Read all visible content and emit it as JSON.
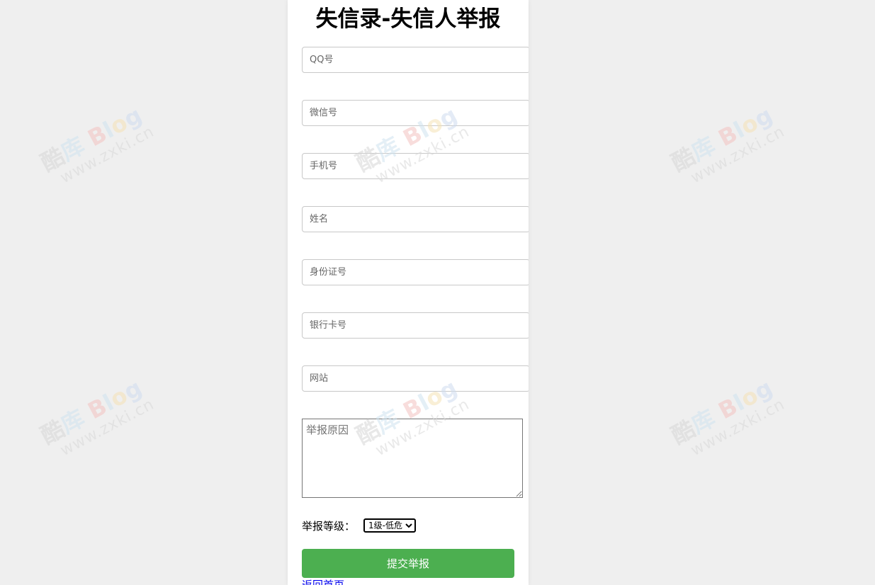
{
  "form": {
    "title": "失信录-失信人举报",
    "fields": {
      "qq": {
        "placeholder": "QQ号"
      },
      "wechat": {
        "placeholder": "微信号"
      },
      "phone": {
        "placeholder": "手机号"
      },
      "name": {
        "placeholder": "姓名"
      },
      "id_card": {
        "placeholder": "身份证号"
      },
      "bank_card": {
        "placeholder": "银行卡号"
      },
      "website": {
        "placeholder": "网站"
      },
      "reason": {
        "placeholder": "举报原因"
      }
    },
    "level_label": "举报等级：",
    "level_selected": "1级-低危",
    "submit_label": "提交举报",
    "back_link": "返回首页"
  },
  "watermark": {
    "logo_text": "酷库Blog",
    "url_text": "www.zxki.cn"
  },
  "colors": {
    "background": "#efefef",
    "card": "#ffffff",
    "submit_button": "#4caf50",
    "link": "#0000ee"
  }
}
